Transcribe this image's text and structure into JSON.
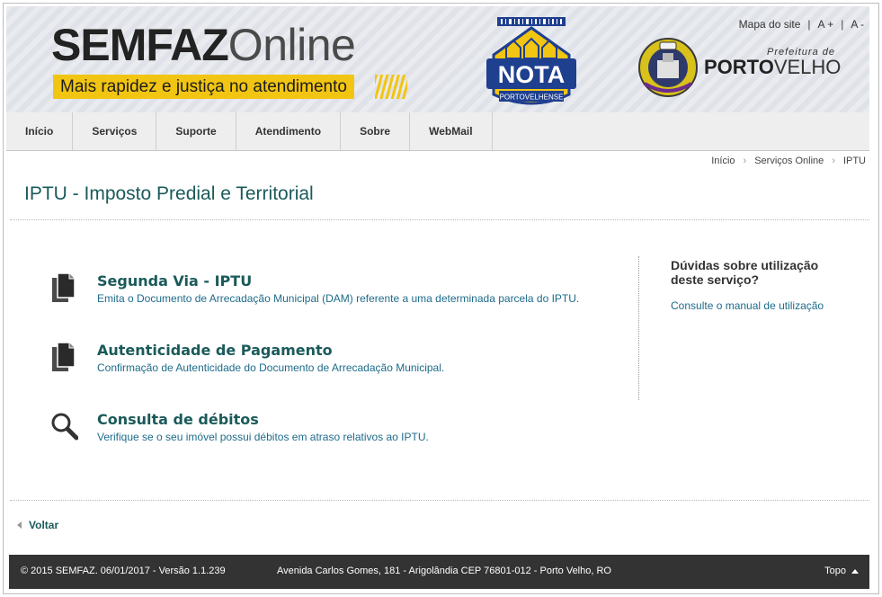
{
  "banner": {
    "logo_bold": "SEMFAZ",
    "logo_light": "Online",
    "tagline": "Mais rapidez e justiça no atendimento",
    "nota_label": "NOTA",
    "nota_sub": "PORTOVELHENSE",
    "prefeitura_small": "Prefeitura de",
    "porto": "PORTO",
    "velho": "VELHO"
  },
  "toplinks": {
    "sitemap": "Mapa do site",
    "sep": "|",
    "font_up": "A +",
    "font_down": "A -"
  },
  "nav": [
    "Início",
    "Serviços",
    "Suporte",
    "Atendimento",
    "Sobre",
    "WebMail"
  ],
  "breadcrumb": {
    "home": "Início",
    "services": "Serviços Online",
    "current": "IPTU",
    "arrow": "›"
  },
  "page_title": "IPTU - Imposto Predial e Territorial",
  "services": [
    {
      "title": "Segunda Via - IPTU",
      "desc": "Emita o Documento de Arrecadação Municipal (DAM) referente a uma determinada parcela do IPTU.",
      "icon": "documents-icon"
    },
    {
      "title": "Autenticidade de Pagamento",
      "desc": "Confirmação de Autenticidade do Documento de Arrecadação Municipal.",
      "icon": "documents-icon"
    },
    {
      "title": "Consulta de débitos",
      "desc": "Verifique se o seu imóvel possui débitos em atraso relativos ao IPTU.",
      "icon": "search-icon"
    }
  ],
  "help": {
    "title": "Dúvidas sobre utilização deste serviço?",
    "link": "Consulte o manual de utilização"
  },
  "back_label": "Voltar",
  "footer": {
    "copyright": "© 2015 SEMFAZ. 06/01/2017 - Versão 1.1.239",
    "address": "Avenida Carlos Gomes, 181 - Arigolândia CEP 76801-012 - Porto Velho, RO",
    "top": "Topo"
  },
  "colors": {
    "accent": "#1b5a5a",
    "link": "#1e6b8a",
    "tagline_bg": "#f2c512",
    "footer_bg": "#333333",
    "nota_blue": "#1f3f8f"
  }
}
